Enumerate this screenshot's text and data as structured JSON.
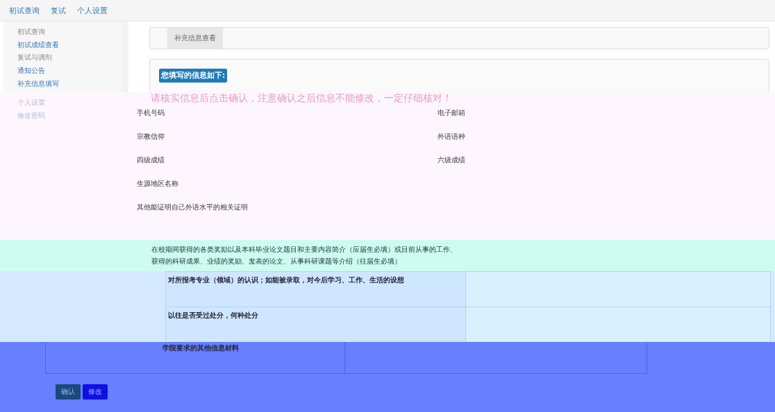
{
  "nav_tabs": [
    "初试查询",
    "复试",
    "个人设置"
  ],
  "sidebar": {
    "groups": [
      {
        "title": "初试查询",
        "items": [
          "初试成绩查看"
        ]
      },
      {
        "title": "复试与调剂",
        "items": [
          "通知公告",
          "补充信息填写"
        ]
      },
      {
        "title": "个人设置",
        "items": [
          "修改密码"
        ]
      }
    ]
  },
  "content_tabs": [
    {
      "label": "补充信息查看",
      "selected": true
    }
  ],
  "info_badge": "您填写的信息如下:",
  "notice": "请核实信息后点击确认，注意确认之后信息不能修改，一定仔细核对！",
  "field_rows": [
    {
      "left": "手机号码",
      "right": "电子邮箱"
    },
    {
      "left": "宗教信仰",
      "right": "外语语种"
    },
    {
      "left": "四级成绩",
      "right": "六级成绩"
    },
    {
      "left": "生源地区名称"
    },
    {
      "left": "其他能证明自己外语水平的相关证明"
    }
  ],
  "description": "在校期间获得的各类奖励以及本科毕业论文题目和主要内容简介（应届生必填）或目前从事的工作、获得的科研成果、业绩的奖励、发表的论文、从事科研课题等介绍（往届生必填）",
  "table_rows": [
    "对所报考专业（领域）的认识；如能被录取，对今后学习、工作、生活的设想",
    "以往是否受过处分，何种处分",
    "学院要求的其他信息材料"
  ],
  "buttons": [
    {
      "label": "确认",
      "kind": "primary"
    },
    {
      "label": "修改",
      "kind": "secondary"
    }
  ]
}
